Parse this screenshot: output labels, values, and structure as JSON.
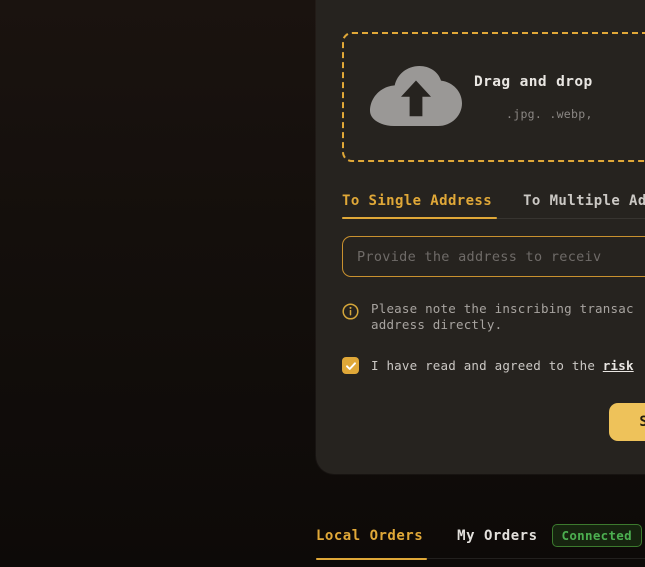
{
  "card": {
    "dropzone": {
      "icon": "cloud-upload-icon",
      "title": "Drag and drop",
      "formats": ".jpg. .webp,"
    },
    "tabs": [
      {
        "label": "To Single Address",
        "active": true
      },
      {
        "label": "To Multiple Ad",
        "active": false
      }
    ],
    "address_input": {
      "value": "",
      "placeholder": "Provide the address to receiv"
    },
    "note": {
      "icon": "info-circle-icon",
      "line1": "Please note the inscribing transac",
      "line2": "address directly."
    },
    "agreement": {
      "checked": true,
      "icon": "check-icon",
      "text": "I have read and agreed to the ",
      "link_text": "risk"
    },
    "submit": {
      "label": "Submi"
    }
  },
  "orders": {
    "tabs": [
      {
        "label": "Local Orders",
        "active": true
      },
      {
        "label": "My Orders",
        "active": false
      }
    ],
    "status_badge": "Connected"
  },
  "colors": {
    "accent": "#e0a838",
    "submit_bg": "#eec25a",
    "connected_text": "#4caf50",
    "connected_bg": "#16240f",
    "card_bg": "#26231f",
    "page_bg": "#0c0a09"
  }
}
